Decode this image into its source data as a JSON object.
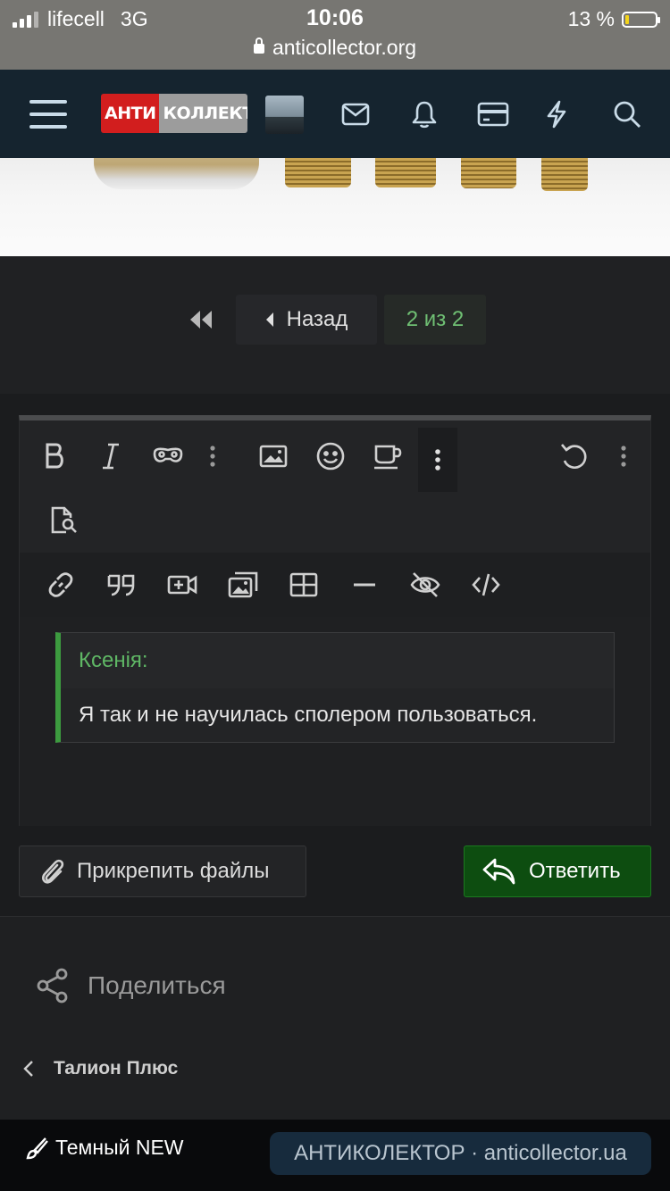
{
  "status_bar": {
    "carrier": "lifecell",
    "network": "3G",
    "time": "10:06",
    "battery_percent": "13 %",
    "battery_level": 0.13,
    "url": "anticollector.org"
  },
  "header": {
    "logo_part1": "АНТИ",
    "logo_part2": "КОЛЛЕКТОР"
  },
  "pager": {
    "back_label": "Назад",
    "current_page": "2 из 2"
  },
  "editor": {
    "quote_author": "Ксенія:",
    "quote_text": "Я так и не научилась сполером пользоваться."
  },
  "actions": {
    "attach_label": "Прикрепить файлы",
    "reply_label": "Ответить"
  },
  "share_label": "Поделиться",
  "breadcrumb_label": "Талион Плюс",
  "footer": {
    "theme_label": "Темный NEW",
    "site_label": "АНТИКОЛЕКТОР · anticollector.ua"
  },
  "colors": {
    "accent_green": "#5fb765",
    "reply_bg": "#0d4d10",
    "navbar_bg": "#15242f",
    "logo_red": "#d21e1e"
  }
}
